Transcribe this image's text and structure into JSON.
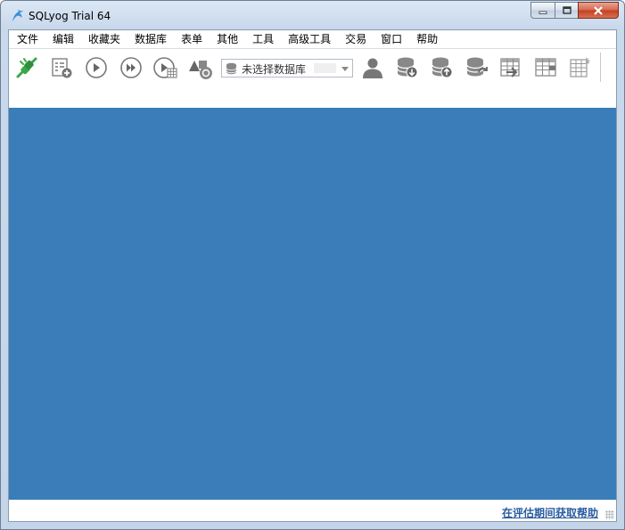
{
  "window": {
    "title": "SQLyog Trial 64"
  },
  "menu": [
    "文件",
    "编辑",
    "收藏夹",
    "数据库",
    "表单",
    "其他",
    "工具",
    "高级工具",
    "交易",
    "窗口",
    "帮助"
  ],
  "toolbar": {
    "icons": [
      "connect-icon",
      "new-query-icon",
      "execute-icon",
      "execute-all-icon",
      "execute-edit-icon",
      "schema-designer-icon",
      "user-manager-icon",
      "backup-db-icon",
      "restore-db-icon",
      "database-sync-icon",
      "import-table-icon",
      "export-table-icon",
      "table-data-icon"
    ],
    "db_select": {
      "value": "未选择数据库"
    }
  },
  "status": {
    "help_link": "在评估期间获取帮助"
  },
  "colors": {
    "workarea": "#3a7db8",
    "accent_green": "#3aa84a",
    "link": "#2a5da0"
  }
}
